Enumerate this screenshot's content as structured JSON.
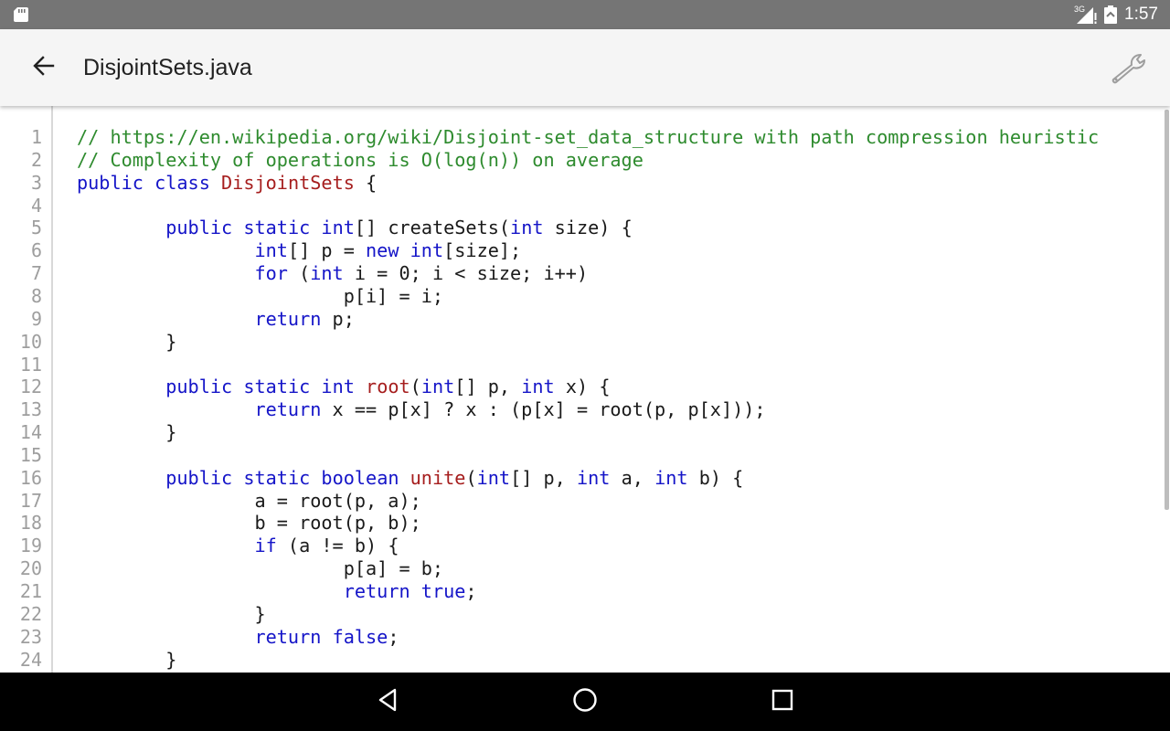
{
  "status_bar": {
    "network_type": "3G",
    "time": "1:57",
    "icons": [
      "sd-card-icon",
      "signal-icon",
      "battery-icon"
    ]
  },
  "app_bar": {
    "title": "DisjointSets.java",
    "back_icon": "arrow-left-icon",
    "action_icon": "wrench-icon"
  },
  "editor": {
    "tab_width": 8,
    "lines": [
      [
        {
          "t": "// https://en.wikipedia.org/wiki/Disjoint-set_data_structure with path compression heuristic",
          "c": "comment"
        }
      ],
      [
        {
          "t": "// Complexity of operations is O(log(n)) on average",
          "c": "comment"
        }
      ],
      [
        {
          "t": "public",
          "c": "keyword"
        },
        {
          "t": " ",
          "c": "plain"
        },
        {
          "t": "class",
          "c": "keyword"
        },
        {
          "t": " ",
          "c": "plain"
        },
        {
          "t": "DisjointSets",
          "c": "name"
        },
        {
          "t": " {",
          "c": "plain"
        }
      ],
      [],
      [
        {
          "t": "        ",
          "c": "plain"
        },
        {
          "t": "public",
          "c": "keyword"
        },
        {
          "t": " ",
          "c": "plain"
        },
        {
          "t": "static",
          "c": "keyword"
        },
        {
          "t": " ",
          "c": "plain"
        },
        {
          "t": "int",
          "c": "keyword"
        },
        {
          "t": "[] createSets(",
          "c": "plain"
        },
        {
          "t": "int",
          "c": "keyword"
        },
        {
          "t": " size) {",
          "c": "plain"
        }
      ],
      [
        {
          "t": "                ",
          "c": "plain"
        },
        {
          "t": "int",
          "c": "keyword"
        },
        {
          "t": "[] p = ",
          "c": "plain"
        },
        {
          "t": "new",
          "c": "keyword"
        },
        {
          "t": " ",
          "c": "plain"
        },
        {
          "t": "int",
          "c": "keyword"
        },
        {
          "t": "[size];",
          "c": "plain"
        }
      ],
      [
        {
          "t": "                ",
          "c": "plain"
        },
        {
          "t": "for",
          "c": "keyword"
        },
        {
          "t": " (",
          "c": "plain"
        },
        {
          "t": "int",
          "c": "keyword"
        },
        {
          "t": " i = 0; i < size; i++)",
          "c": "plain"
        }
      ],
      [
        {
          "t": "                        p[i] = i;",
          "c": "plain"
        }
      ],
      [
        {
          "t": "                ",
          "c": "plain"
        },
        {
          "t": "return",
          "c": "keyword"
        },
        {
          "t": " p;",
          "c": "plain"
        }
      ],
      [
        {
          "t": "        }",
          "c": "plain"
        }
      ],
      [],
      [
        {
          "t": "        ",
          "c": "plain"
        },
        {
          "t": "public",
          "c": "keyword"
        },
        {
          "t": " ",
          "c": "plain"
        },
        {
          "t": "static",
          "c": "keyword"
        },
        {
          "t": " ",
          "c": "plain"
        },
        {
          "t": "int",
          "c": "keyword"
        },
        {
          "t": " ",
          "c": "plain"
        },
        {
          "t": "root",
          "c": "name"
        },
        {
          "t": "(",
          "c": "plain"
        },
        {
          "t": "int",
          "c": "keyword"
        },
        {
          "t": "[] p, ",
          "c": "plain"
        },
        {
          "t": "int",
          "c": "keyword"
        },
        {
          "t": " x) {",
          "c": "plain"
        }
      ],
      [
        {
          "t": "                ",
          "c": "plain"
        },
        {
          "t": "return",
          "c": "keyword"
        },
        {
          "t": " x == p[x] ? x : (p[x] = root(p, p[x]));",
          "c": "plain"
        }
      ],
      [
        {
          "t": "        }",
          "c": "plain"
        }
      ],
      [],
      [
        {
          "t": "        ",
          "c": "plain"
        },
        {
          "t": "public",
          "c": "keyword"
        },
        {
          "t": " ",
          "c": "plain"
        },
        {
          "t": "static",
          "c": "keyword"
        },
        {
          "t": " ",
          "c": "plain"
        },
        {
          "t": "boolean",
          "c": "keyword"
        },
        {
          "t": " ",
          "c": "plain"
        },
        {
          "t": "unite",
          "c": "name"
        },
        {
          "t": "(",
          "c": "plain"
        },
        {
          "t": "int",
          "c": "keyword"
        },
        {
          "t": "[] p, ",
          "c": "plain"
        },
        {
          "t": "int",
          "c": "keyword"
        },
        {
          "t": " a, ",
          "c": "plain"
        },
        {
          "t": "int",
          "c": "keyword"
        },
        {
          "t": " b) {",
          "c": "plain"
        }
      ],
      [
        {
          "t": "                a = root(p, a);",
          "c": "plain"
        }
      ],
      [
        {
          "t": "                b = root(p, b);",
          "c": "plain"
        }
      ],
      [
        {
          "t": "                ",
          "c": "plain"
        },
        {
          "t": "if",
          "c": "keyword"
        },
        {
          "t": " (a != b) {",
          "c": "plain"
        }
      ],
      [
        {
          "t": "                        p[a] = b;",
          "c": "plain"
        }
      ],
      [
        {
          "t": "                        ",
          "c": "plain"
        },
        {
          "t": "return",
          "c": "keyword"
        },
        {
          "t": " ",
          "c": "plain"
        },
        {
          "t": "true",
          "c": "keyword"
        },
        {
          "t": ";",
          "c": "plain"
        }
      ],
      [
        {
          "t": "                }",
          "c": "plain"
        }
      ],
      [
        {
          "t": "                ",
          "c": "plain"
        },
        {
          "t": "return",
          "c": "keyword"
        },
        {
          "t": " ",
          "c": "plain"
        },
        {
          "t": "false",
          "c": "keyword"
        },
        {
          "t": ";",
          "c": "plain"
        }
      ],
      [
        {
          "t": "        }",
          "c": "plain"
        }
      ]
    ],
    "colors": {
      "comment": "#2e8b2e",
      "keyword": "#1515c8",
      "name": "#a61e1e",
      "plain": "#1a1a1a",
      "line_number": "#9e9e9e"
    }
  },
  "nav_bar": {
    "buttons": [
      "back-triangle-icon",
      "home-circle-icon",
      "recents-square-icon"
    ]
  }
}
